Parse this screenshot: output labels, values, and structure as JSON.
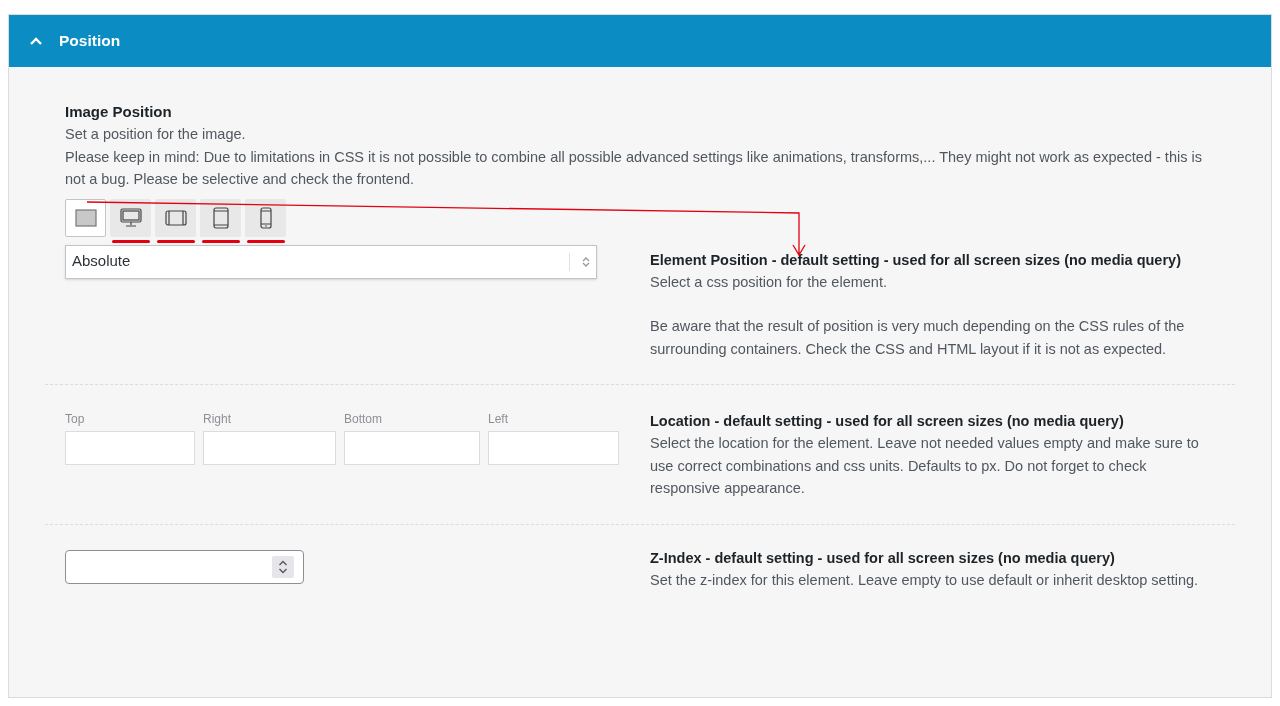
{
  "header": {
    "title": "Position",
    "expanded": true
  },
  "intro": {
    "title": "Image Position",
    "lines": [
      "Set a position for the image.",
      "Please keep in mind: Due to limitations in CSS it is not possible to combine all possible advanced settings like animations, transforms,... They might not work as expected - this is not a bug. Please be selective and check the frontend."
    ]
  },
  "devices": [
    {
      "kind": "all",
      "selected": true,
      "marked": false
    },
    {
      "kind": "desktop",
      "selected": false,
      "marked": true
    },
    {
      "kind": "tablet-landscape",
      "selected": false,
      "marked": true
    },
    {
      "kind": "tablet",
      "selected": false,
      "marked": true
    },
    {
      "kind": "phone",
      "selected": false,
      "marked": true
    }
  ],
  "position_select": {
    "value": "Absolute"
  },
  "sections": [
    {
      "kind": "select",
      "title": "Element Position - default setting - used for all screen sizes (no media query)",
      "paragraphs": [
        "Select a css position for the element.",
        "Be aware that the result of position is very much depending on the CSS rules of the surrounding containers. Check the CSS and HTML layout if it is not as expected."
      ]
    },
    {
      "kind": "location",
      "title": "Location - default setting - used for all screen sizes (no media query)",
      "paragraphs": [
        "Select the location for the element. Leave not needed values empty and make sure to use correct combinations and css units. Defaults to px. Do not forget to check responsive appearance."
      ],
      "fields": [
        "Top",
        "Right",
        "Bottom",
        "Left"
      ]
    },
    {
      "kind": "number",
      "title": "Z-Index - default setting - used for all screen sizes (no media query)",
      "paragraphs": [
        "Set the z-index for this element. Leave empty to use default or inherit desktop setting."
      ]
    }
  ]
}
